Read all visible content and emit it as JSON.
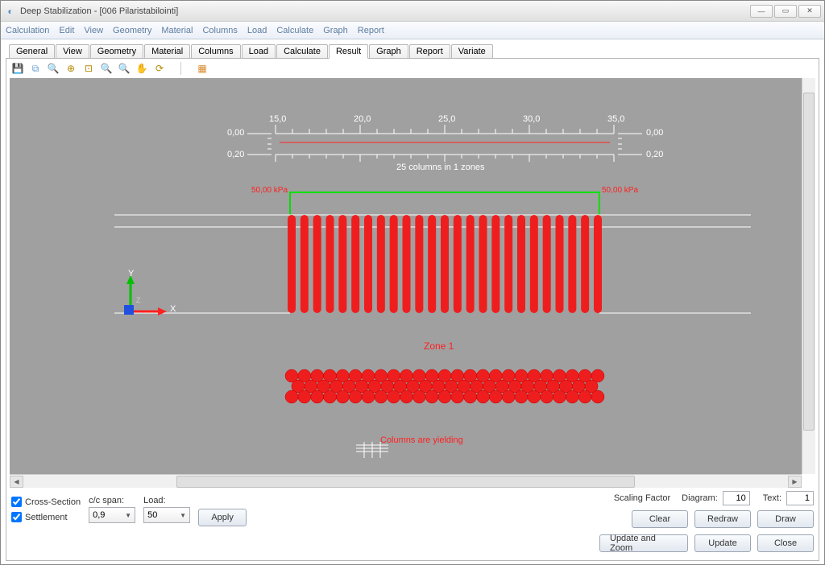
{
  "window": {
    "title": "Deep Stabilization - [006 Pilaristabilointi]"
  },
  "menubar": [
    "Calculation",
    "Edit",
    "View",
    "Geometry",
    "Material",
    "Columns",
    "Load",
    "Calculate",
    "Graph",
    "Report"
  ],
  "tabs": [
    {
      "label": "General"
    },
    {
      "label": "View"
    },
    {
      "label": "Geometry"
    },
    {
      "label": "Material"
    },
    {
      "label": "Columns"
    },
    {
      "label": "Load"
    },
    {
      "label": "Calculate"
    },
    {
      "label": "Result",
      "active": true
    },
    {
      "label": "Graph"
    },
    {
      "label": "Report"
    },
    {
      "label": "Variate"
    }
  ],
  "toolbar_icons": [
    {
      "name": "save-icon",
      "glyph": "💾",
      "color": "#3a5fa0"
    },
    {
      "name": "copy-icon",
      "glyph": "⧉",
      "color": "#6a9fd4"
    },
    {
      "name": "zoom-in-icon",
      "glyph": "🔍",
      "color": "#b38a00"
    },
    {
      "name": "zoom-fit-icon",
      "glyph": "⊕",
      "color": "#b38a00"
    },
    {
      "name": "zoom-window-icon",
      "glyph": "⊡",
      "color": "#b38a00"
    },
    {
      "name": "zoom-out-icon",
      "glyph": "🔍",
      "color": "#b38a00"
    },
    {
      "name": "zoom-reset-icon",
      "glyph": "🔍",
      "color": "#b38a00"
    },
    {
      "name": "pan-icon",
      "glyph": "✋",
      "color": "#b38a00"
    },
    {
      "name": "redraw-icon",
      "glyph": "⟳",
      "color": "#b38a00"
    },
    {
      "name": "spacer",
      "glyph": "",
      "color": ""
    },
    {
      "name": "settings-icon",
      "glyph": "▦",
      "color": "#d88a2a"
    }
  ],
  "canvas": {
    "ruler_ticks": [
      "15,0",
      "20,0",
      "25,0",
      "30,0",
      "35,0"
    ],
    "ruler_left_top": "0,00",
    "ruler_left_bottom": "0,20",
    "ruler_right_top": "0,00",
    "ruler_right_bottom": "0,20",
    "ruler_caption": "25 columns in 1 zones",
    "load_left": "50,00 kPa",
    "load_right": "50,00 kPa",
    "axis_y": "Y",
    "axis_x": "X",
    "axis_z": "Z",
    "zone_label": "Zone 1",
    "status_text": "Columns are yielding",
    "columns_count": 25
  },
  "options": {
    "cross_section_label": "Cross-Section",
    "cross_section_checked": true,
    "settlement_label": "Settlement",
    "settlement_checked": true,
    "cc_span_label": "c/c span:",
    "cc_span_value": "0,9",
    "load_label": "Load:",
    "load_value": "50",
    "apply_label": "Apply",
    "scaling_label": "Scaling Factor",
    "diagram_label": "Diagram:",
    "diagram_value": "10",
    "text_label": "Text:",
    "text_value": "1"
  },
  "buttons": {
    "clear": "Clear",
    "redraw": "Redraw",
    "draw": "Draw",
    "update_zoom": "Update and Zoom",
    "update": "Update",
    "close": "Close"
  },
  "chart_data": {
    "type": "diagram",
    "ruler_x_range": [
      15.0,
      35.0
    ],
    "ruler_y_range": [
      0.0,
      0.2
    ],
    "applied_load_kpa": 50.0,
    "zones": [
      {
        "name": "Zone 1",
        "columns": 25
      }
    ],
    "status": "Columns are yielding"
  }
}
